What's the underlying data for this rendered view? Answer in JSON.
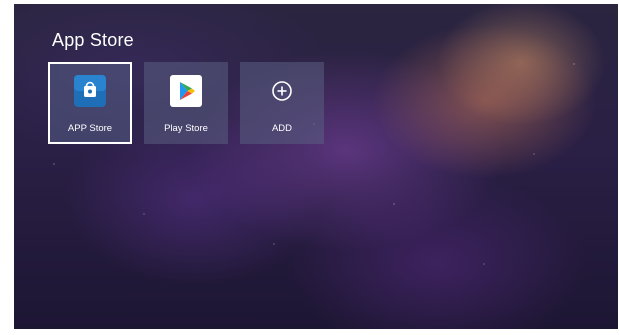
{
  "section": {
    "title": "App Store"
  },
  "apps": [
    {
      "label": "APP Store",
      "icon": "app-store-bag-icon",
      "focused": true
    },
    {
      "label": "Play Store",
      "icon": "google-play-icon",
      "focused": false
    },
    {
      "label": "ADD",
      "icon": "plus-circle-icon",
      "focused": false
    }
  ],
  "colors": {
    "tile_background": "#5a5f82",
    "focus_border": "#ffffff",
    "app_store_icon_background": "#1f6fb8",
    "play_store_icon_background": "#ffffff"
  }
}
